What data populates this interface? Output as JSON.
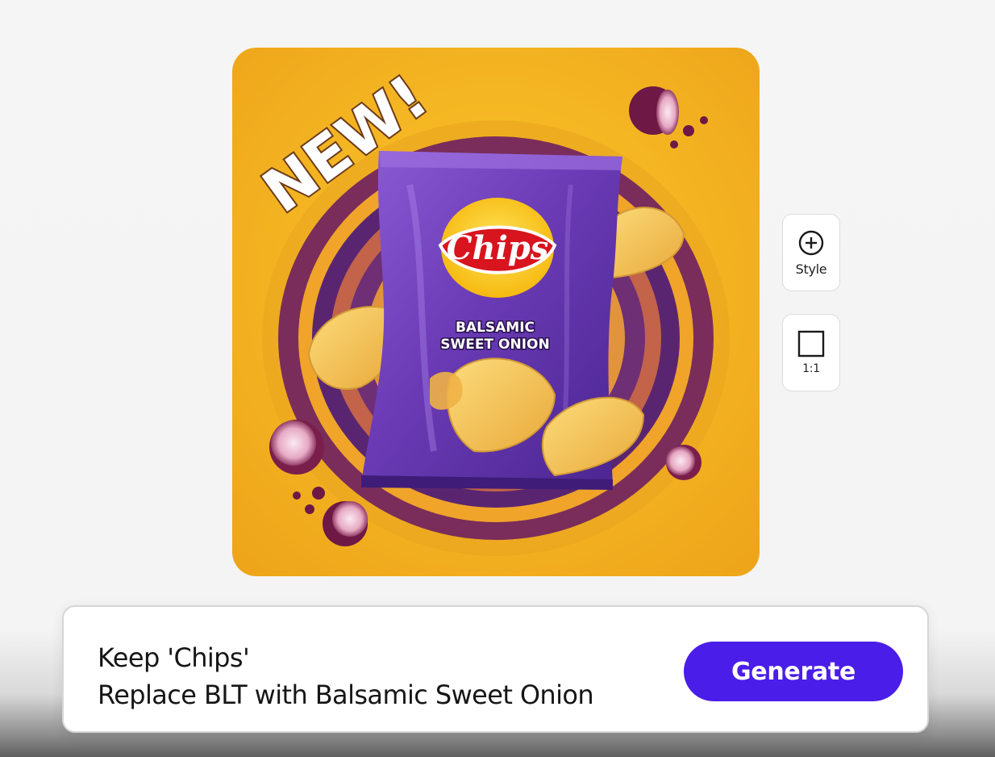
{
  "image": {
    "badge_text": "NEW!",
    "brand_text": "Chips",
    "flavor_line1": "BALSAMIC",
    "flavor_line2": "SWEET ONION"
  },
  "tools": {
    "style": {
      "label": "Style",
      "icon": "plus-circle-icon"
    },
    "ratio": {
      "label": "1:1",
      "icon": "square-icon"
    }
  },
  "prompt": {
    "line1": "Keep 'Chips'",
    "line2": "Replace BLT with Balsamic Sweet Onion"
  },
  "generate_button": {
    "label": "Generate"
  },
  "colors": {
    "accent": "#4a1de8",
    "background_yellow": "#f2b51f",
    "bag_purple": "#6e3fb8"
  }
}
